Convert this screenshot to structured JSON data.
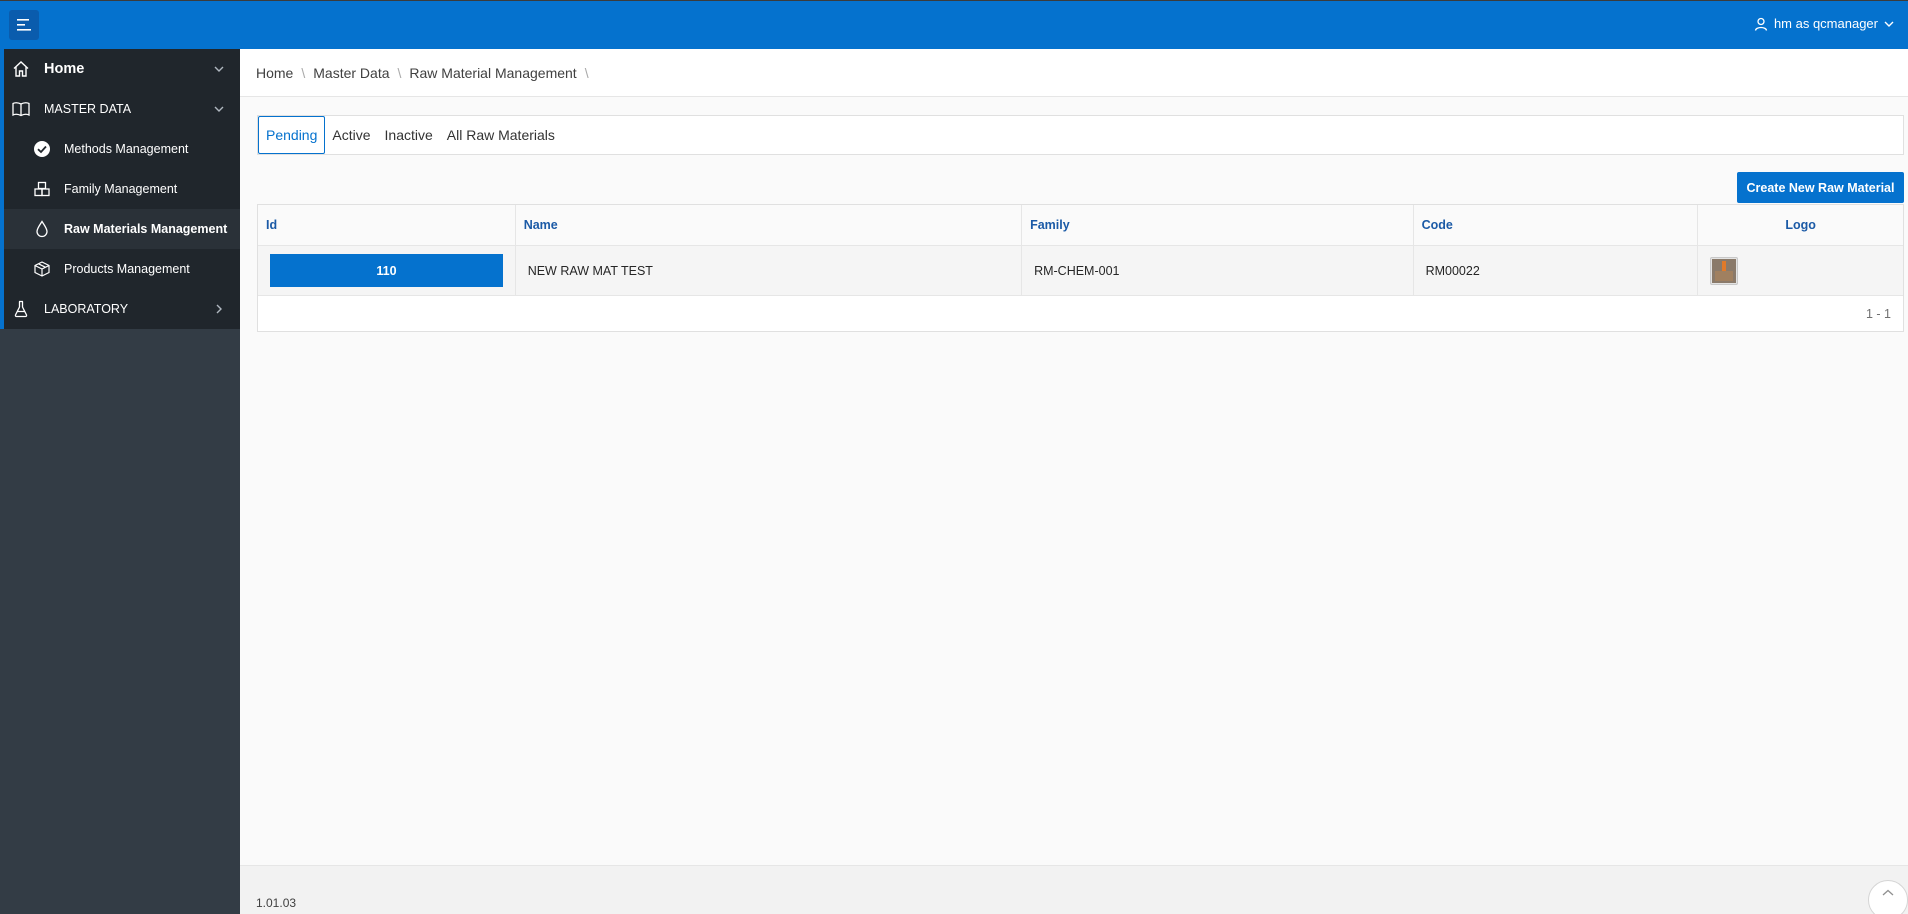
{
  "header": {
    "user_label": "hm as qcmanager"
  },
  "sidebar": {
    "items": [
      {
        "label": "Home",
        "icon": "home-icon"
      },
      {
        "label": "MASTER DATA",
        "icon": "book-icon"
      },
      {
        "label": "Methods Management",
        "icon": "check-circle-icon"
      },
      {
        "label": "Family Management",
        "icon": "boxes-icon"
      },
      {
        "label": "Raw Materials Management",
        "icon": "drop-icon"
      },
      {
        "label": "Products Management",
        "icon": "package-icon"
      },
      {
        "label": "LABORATORY",
        "icon": "flask-icon"
      }
    ]
  },
  "breadcrumb": {
    "items": [
      "Home",
      "Master Data",
      "Raw Material Management"
    ]
  },
  "tabs": [
    "Pending",
    "Active",
    "Inactive",
    "All Raw Materials"
  ],
  "create_button": "Create New Raw Material",
  "table": {
    "columns": [
      "Id",
      "Name",
      "Family",
      "Code",
      "Logo"
    ],
    "rows": [
      {
        "id": "110",
        "name": "NEW RAW MAT TEST",
        "family": "RM-CHEM-001",
        "code": "RM00022"
      }
    ],
    "pagination": "1 - 1"
  },
  "footer": {
    "version": "1.01.03"
  },
  "colors": {
    "accent": "#0572ce",
    "sidebar": "#20262c"
  }
}
